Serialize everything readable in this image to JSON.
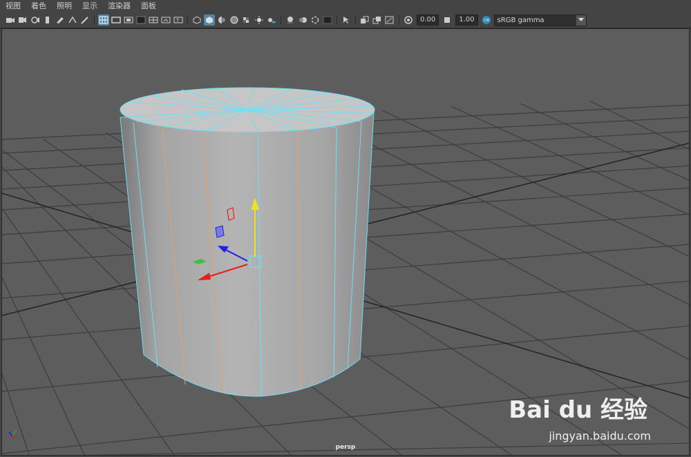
{
  "menubar": {
    "items": [
      "视图",
      "着色",
      "照明",
      "显示",
      "渲染器",
      "面板"
    ]
  },
  "toolbar": {
    "exposure_value": "0.00",
    "gamma_value": "1.00",
    "color_space": "sRGB gamma",
    "icons": [
      "camera-icon",
      "camera-attributes-icon",
      "bookmark-icon",
      "image-plane-icon",
      "grease-pencil-icon",
      "2d-pan-zoom-icon",
      "wireframe-grid-icon",
      "film-gate-icon",
      "resolution-gate-icon",
      "gate-mask-icon",
      "field-chart-icon",
      "safe-action-icon",
      "safe-title-icon",
      "wireframe-icon",
      "smooth-shade-icon",
      "use-default-material-icon",
      "wireframe-on-shaded-icon",
      "textured-icon",
      "use-all-lights-icon",
      "shadows-icon",
      "screen-space-ambient-occlusion-icon",
      "motion-blur-icon",
      "anti-aliasing-icon",
      "depth-of-field-icon",
      "isolate-select-icon",
      "xray-icon",
      "xray-joints-icon",
      "xray-active-components-icon",
      "exposure-icon",
      "gamma-icon",
      "color-management-icon"
    ]
  },
  "viewport": {
    "camera_label": "persp",
    "colors": {
      "background": "#5d5d5d",
      "grid": "#3c3c3c",
      "mesh_edges": "#6ee0f5",
      "seam_edges": "#e9a060",
      "axis_x": "#e02020",
      "axis_y": "#f0e020",
      "axis_z": "#2020e0"
    }
  },
  "watermark": {
    "brand": "Bai du 经验",
    "url": "jingyan.baidu.com"
  }
}
